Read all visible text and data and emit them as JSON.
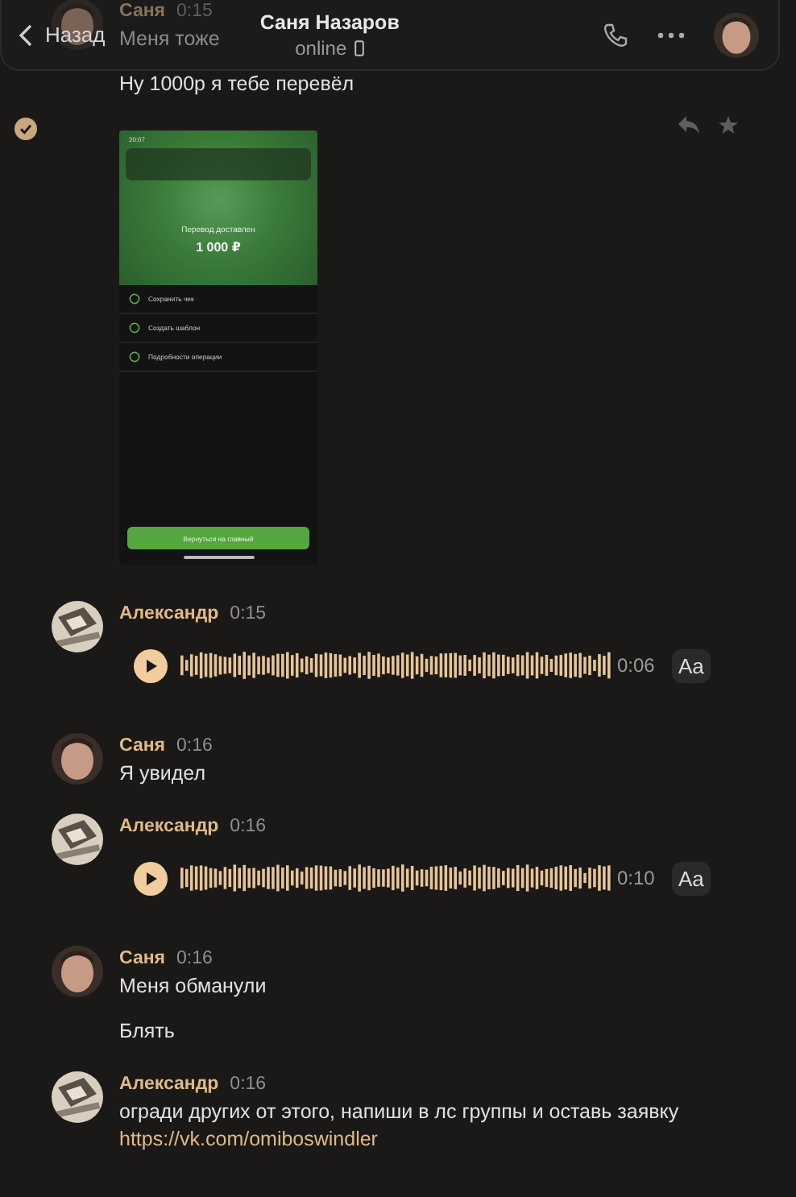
{
  "header": {
    "back_label": "Назад",
    "title": "Саня Назаров",
    "status": "online"
  },
  "messages": [
    {
      "author": "Саня",
      "time": "0:15",
      "avatar": {
        "kind": "face"
      },
      "selected": true,
      "items": [
        {
          "kind": "text",
          "text": "Меня тоже"
        },
        {
          "kind": "text",
          "text": "Ну 1000р я тебе перевёл"
        },
        {
          "kind": "screenshot",
          "screen": {
            "time": "20:07",
            "title": "Перевод доставлен",
            "amount": "1 000 ₽",
            "actions": [
              "Сохранить чек",
              "Создать шаблон",
              "Подробности операции"
            ],
            "button": "Вернуться на главный"
          }
        }
      ]
    },
    {
      "author": "Александр",
      "time": "0:15",
      "avatar": {
        "kind": "object"
      },
      "selected": false,
      "items": [
        {
          "kind": "voice",
          "duration": "0:06",
          "transcribe": "Aa"
        }
      ]
    },
    {
      "author": "Саня",
      "time": "0:16",
      "avatar": {
        "kind": "face"
      },
      "selected": false,
      "items": [
        {
          "kind": "text",
          "text": "Я увидел"
        }
      ]
    },
    {
      "author": "Александр",
      "time": "0:16",
      "avatar": {
        "kind": "object"
      },
      "selected": false,
      "items": [
        {
          "kind": "voice",
          "duration": "0:10",
          "transcribe": "Aa"
        }
      ]
    },
    {
      "author": "Саня",
      "time": "0:16",
      "avatar": {
        "kind": "face"
      },
      "selected": false,
      "items": [
        {
          "kind": "text",
          "text": "Меня обманули"
        },
        {
          "kind": "text",
          "text": "Блять"
        }
      ]
    },
    {
      "author": "Александр",
      "time": "0:16",
      "avatar": {
        "kind": "object"
      },
      "selected": false,
      "items": [
        {
          "kind": "text_link",
          "text": "огради других от этого, напиши в лс группы и оставь заявку",
          "link": "https://vk.com/omiboswindler"
        }
      ]
    }
  ]
}
